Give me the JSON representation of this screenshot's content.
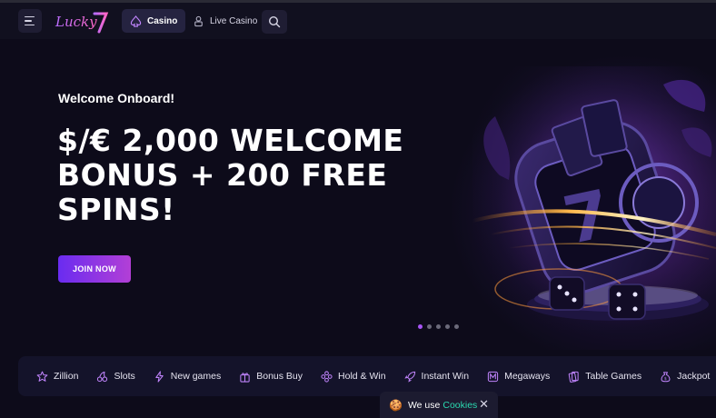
{
  "header": {
    "logo_text": "Lucky7",
    "tabs": [
      {
        "label": "Casino",
        "icon": "spade-icon",
        "active": true
      },
      {
        "label": "Live Casino",
        "icon": "dealer-icon",
        "active": false
      }
    ]
  },
  "hero": {
    "kicker": "Welcome Onboard!",
    "headline": "$/€ 2,000 WELCOME BONUS + 200 FREE SPINS!",
    "cta_label": "JOIN NOW",
    "slide_count": 5,
    "active_slide": 1
  },
  "categories": [
    {
      "label": "Zillion",
      "icon": "star-icon"
    },
    {
      "label": "Slots",
      "icon": "cherry-icon"
    },
    {
      "label": "New games",
      "icon": "lightning-icon"
    },
    {
      "label": "Bonus Buy",
      "icon": "gift-icon"
    },
    {
      "label": "Hold & Win",
      "icon": "grid-icon"
    },
    {
      "label": "Instant Win",
      "icon": "rocket-icon"
    },
    {
      "label": "Megaways",
      "icon": "megaways-icon"
    },
    {
      "label": "Table Games",
      "icon": "cards-icon"
    },
    {
      "label": "Jackpot",
      "icon": "moneybag-icon"
    }
  ],
  "cookie": {
    "text": "We use",
    "link": "Cookies",
    "close": "✕"
  },
  "colors": {
    "accent": "#a855f7",
    "background": "#0d0b1a",
    "cookie_link": "#2ad9b0"
  }
}
